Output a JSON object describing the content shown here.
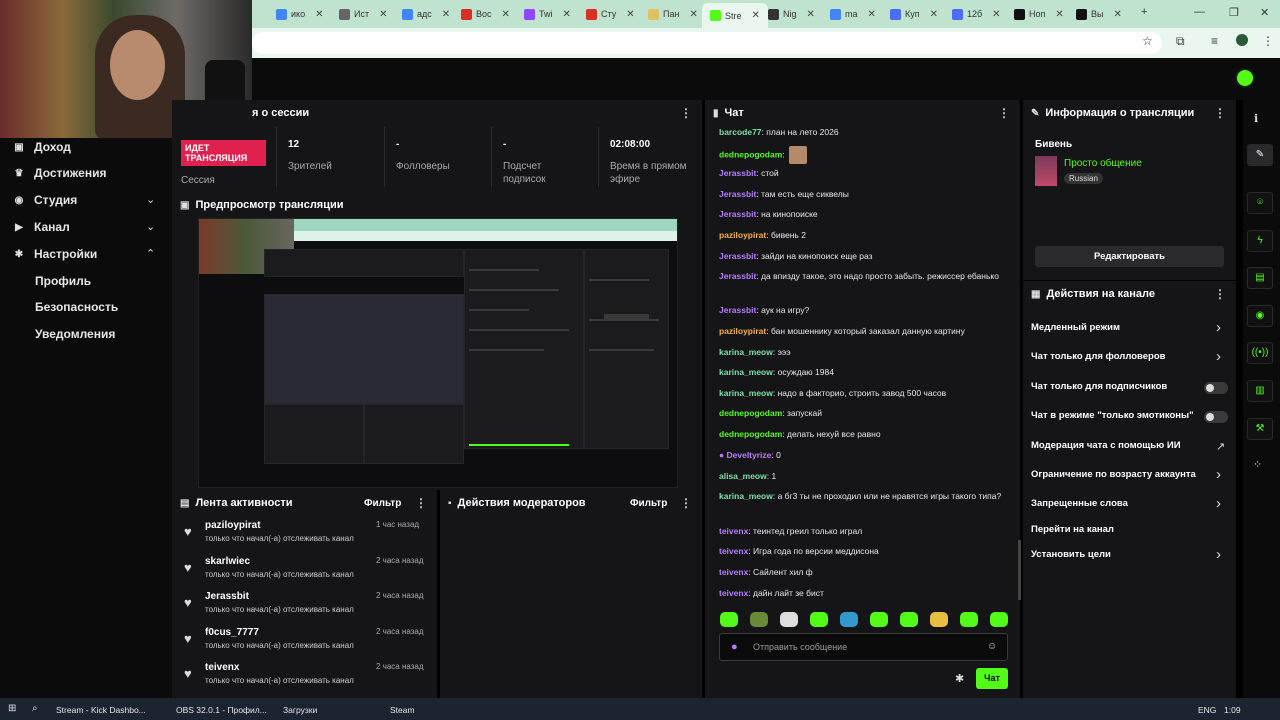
{
  "browser": {
    "tabs": [
      {
        "label": "ико",
        "color": "#4285f4"
      },
      {
        "label": "Ист",
        "color": "#666666"
      },
      {
        "label": "адс",
        "color": "#4285f4"
      },
      {
        "label": "Вос",
        "color": "#d93025"
      },
      {
        "label": "Twi",
        "color": "#9146ff"
      },
      {
        "label": "Сту",
        "color": "#d93025"
      },
      {
        "label": "Пан",
        "color": "#e0c060"
      },
      {
        "label": "Stre",
        "color": "#53fc18"
      },
      {
        "label": "Nig",
        "color": "#333333"
      },
      {
        "label": "ma",
        "color": "#4285f4"
      },
      {
        "label": "Куп",
        "color": "#4a6cf7"
      },
      {
        "label": "12б",
        "color": "#4a6cf7"
      },
      {
        "label": "Ноп",
        "color": "#111111"
      },
      {
        "label": "Вы",
        "color": "#111111"
      }
    ],
    "new_tab": "+",
    "win_min": "—",
    "win_max": "❐",
    "win_close": "✕"
  },
  "session": {
    "title": "я о сессии",
    "live_badge": "ИДЕТ ТРАНСЛЯЦИЯ",
    "session_label": "Сессия",
    "stats": [
      {
        "value": "12",
        "label": "Зрителей"
      },
      {
        "value": "-",
        "label": "Фолловеры"
      },
      {
        "value": "-",
        "label": "Подсчет подписок"
      },
      {
        "value": "02:08:00",
        "label": "Время в прямом эфире"
      }
    ]
  },
  "preview": {
    "title": "Предпросмотр трансляции"
  },
  "sidebar": {
    "items": [
      {
        "label": "Доход",
        "icon": "income-icon"
      },
      {
        "label": "Достижения",
        "icon": "trophy-icon"
      },
      {
        "label": "Студия",
        "icon": "studio-icon"
      },
      {
        "label": "Канал",
        "icon": "channel-icon"
      },
      {
        "label": "Настройки",
        "icon": "gear-icon"
      }
    ],
    "subitems": [
      "Профиль",
      "Безопасность",
      "Уведомления"
    ]
  },
  "activity": {
    "title": "Лента активности",
    "filter": "Фильтр",
    "items": [
      {
        "name": "paziloypirat",
        "text": "только что начал(-а) отслеживать канал",
        "time": "1 час назад"
      },
      {
        "name": "skarlwiec",
        "text": "только что начал(-а) отслеживать канал",
        "time": "2 часа назад"
      },
      {
        "name": "Jerassbit",
        "text": "только что начал(-а) отслеживать канал",
        "time": "2 часа назад"
      },
      {
        "name": "f0cus_7777",
        "text": "только что начал(-а) отслеживать канал",
        "time": "2 часа назад"
      },
      {
        "name": "teivenx",
        "text": "только что начал(-а) отслеживать канал",
        "time": "2 часа назад"
      }
    ]
  },
  "moderators": {
    "title": "Действия модераторов",
    "filter": "Фильтр"
  },
  "chat": {
    "title": "Чат",
    "messages": [
      {
        "user": "barcode77",
        "color": "#7be0a8",
        "text": ": план на лето 2026"
      },
      {
        "user": "dednepogodam",
        "color": "#53fc18",
        "text": ":"
      },
      {
        "user": "Jerassbit",
        "color": "#b57cff",
        "text": ": стой"
      },
      {
        "user": "Jerassbit",
        "color": "#b57cff",
        "text": ": там есть еще сиквелы"
      },
      {
        "user": "Jerassbit",
        "color": "#b57cff",
        "text": ": на кинопоиске"
      },
      {
        "user": "paziloypirat",
        "color": "#f0b43c",
        "text": ": бивень 2"
      },
      {
        "user": "Jerassbit",
        "color": "#b57cff",
        "text": ": зайди на кинопоиск еще раз"
      },
      {
        "user": "Jerassbit",
        "color": "#b57cff",
        "text": ": да впизду такое, это надо просто забыть. режиссер ебанько"
      },
      {
        "user": "Jerassbit",
        "color": "#b57cff",
        "text": ": аук на игру?"
      },
      {
        "user": "paziloypirat",
        "color": "#f0b43c",
        "text": ": бан мошеннику который заказал данную картину"
      },
      {
        "user": "karina_meow",
        "color": "#7be0a8",
        "text": ": эээ"
      },
      {
        "user": "karina_meow",
        "color": "#7be0a8",
        "text": ": осуждаю 1984"
      },
      {
        "user": "karina_meow",
        "color": "#7be0a8",
        "text": ": надо в факторио, строить завод 500 часов"
      },
      {
        "user": "dednepogodam",
        "color": "#53fc18",
        "text": ": запускай"
      },
      {
        "user": "dednepogodam",
        "color": "#53fc18",
        "text": ": делать нехуй все равно"
      },
      {
        "user": "Develtyrize",
        "color": "#b57cff",
        "text": ": 0"
      },
      {
        "user": "alisa_meow",
        "color": "#7be0a8",
        "text": ": 1"
      },
      {
        "user": "karina_meow",
        "color": "#7be0a8",
        "text": ": а бг3 ты не проходил или не нравятся игры такого типа?"
      },
      {
        "user": "teivenx",
        "color": "#b57cff",
        "text": ": теинтед греил только играл"
      },
      {
        "user": "teivenx",
        "color": "#b57cff",
        "text": ": Игра года по версии меддисона"
      },
      {
        "user": "teivenx",
        "color": "#b57cff",
        "text": ": Сайлент хил ф"
      },
      {
        "user": "teivenx",
        "color": "#b57cff",
        "text": ": дайн лайт зе бист"
      }
    ],
    "input_placeholder": "Отправить сообщение",
    "send_button": "Чат"
  },
  "stream_info": {
    "title": "Информация о трансляции",
    "stream_title": "Бивень",
    "category": "Просто общение",
    "language": "Russian",
    "edit_button": "Редактировать"
  },
  "channel_actions": {
    "title": "Действия на канале",
    "items": [
      {
        "label": "Медленный режим",
        "control": "chevron"
      },
      {
        "label": "Чат только для фолловеров",
        "control": "chevron"
      },
      {
        "label": "Чат только для подписчиков",
        "control": "toggle"
      },
      {
        "label": "Чат в режиме \"только эмотиконы\"",
        "control": "toggle"
      },
      {
        "label": "Модерация чата с помощью ИИ",
        "control": "external"
      },
      {
        "label": "Ограничение по возрасту аккаунта",
        "control": "chevron"
      },
      {
        "label": "Запрещенные слова",
        "control": "chevron"
      },
      {
        "label": "Перейти на канал",
        "control": "none"
      },
      {
        "label": "Установить цели",
        "control": "chevron"
      }
    ]
  },
  "taskbar": {
    "items": [
      {
        "label": "Stream - Kick Dashbo..."
      },
      {
        "label": "OBS 32.0.1 - Профил..."
      },
      {
        "label": "Загрузки"
      },
      {
        "label": "Steam"
      }
    ],
    "lang": "ENG",
    "time": "1:09"
  },
  "colors": {
    "accent": "#53fc18",
    "live": "#e0204e",
    "panel": "#151517"
  }
}
